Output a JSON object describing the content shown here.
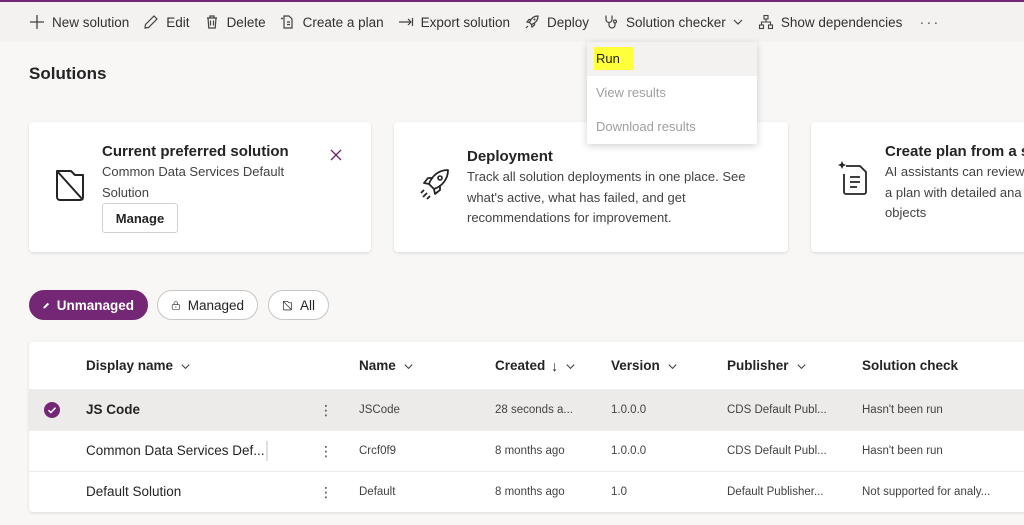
{
  "toolbar": {
    "new_solution": "New solution",
    "edit": "Edit",
    "delete": "Delete",
    "create_plan": "Create a plan",
    "export_solution": "Export solution",
    "deploy": "Deploy",
    "solution_checker": "Solution checker",
    "show_dependencies": "Show dependencies",
    "more": "···"
  },
  "page_title": "Solutions",
  "solution_checker_menu": {
    "items": [
      {
        "label": "Run",
        "enabled": true,
        "highlighted": true
      },
      {
        "label": "View results",
        "enabled": false
      },
      {
        "label": "Download results",
        "enabled": false
      }
    ]
  },
  "cards": {
    "preferred": {
      "title": "Current preferred solution",
      "line1": "Common Data Services Default",
      "line2": "Solution",
      "button": "Manage"
    },
    "deployment": {
      "title": "Deployment",
      "line1": "Track all solution deployments in one place. See",
      "line2": "what's active, what has failed, and get",
      "line3": "recommendations for improvement."
    },
    "plan": {
      "title": "Create plan from a so",
      "line1": "AI assistants can review",
      "line2": "a plan with detailed ana",
      "line3": "objects"
    }
  },
  "filters": {
    "unmanaged": "Unmanaged",
    "managed": "Managed",
    "all": "All",
    "active": "unmanaged"
  },
  "table": {
    "columns": {
      "display_name": "Display name",
      "name": "Name",
      "created": "Created",
      "created_sort": "↓",
      "version": "Version",
      "publisher": "Publisher",
      "solution_check": "Solution check"
    },
    "rows": [
      {
        "display_name": "JS Code",
        "name": "JSCode",
        "created": "28 seconds a...",
        "version": "1.0.0.0",
        "publisher": "CDS Default Publ...",
        "solution_check": "Hasn't been run",
        "selected": true
      },
      {
        "display_name": "Common Data Services Def...",
        "name": "Crcf0f9",
        "created": "8 months ago",
        "version": "1.0.0.0",
        "publisher": "CDS Default Publ...",
        "solution_check": "Hasn't been run",
        "selected": false
      },
      {
        "display_name": "Default Solution",
        "name": "Default",
        "created": "8 months ago",
        "version": "1.0",
        "publisher": "Default Publisher...",
        "solution_check": "Not supported for analy...",
        "selected": false
      }
    ]
  },
  "colors": {
    "accent": "#742774",
    "highlight": "#ffff3a"
  }
}
